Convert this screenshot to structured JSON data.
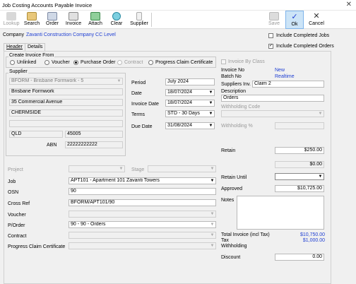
{
  "window": {
    "title": "Job Costing Accounts Payable Invoice",
    "close_symbol": "✕"
  },
  "toolbar": {
    "lookup": "Lookup",
    "search": "Search",
    "order": "Order",
    "invoice": "Invoice",
    "attach": "Attach",
    "clear": "Clear",
    "supplier": "Supplier",
    "save": "Save",
    "ok": "Ok",
    "cancel": "Cancel"
  },
  "company": {
    "label": "Company",
    "value": "Zavanti Construction Company CC Level"
  },
  "options": {
    "include_completed_jobs": "Include Completed Jobs",
    "include_completed_orders": "Include Completed Orders",
    "include_completed_jobs_checked": false,
    "include_completed_orders_checked": true,
    "check_mark": "✓"
  },
  "tabs": {
    "header": "Header",
    "details": "Details"
  },
  "create_from": {
    "label": "Create Invoice From",
    "unlinked": "Unlinked",
    "voucher": "Voucher",
    "purchase_order": "Purchase Order",
    "contract": "Contract",
    "progress_claim": "Progress Claim Certificate",
    "selected": "purchase_order"
  },
  "supplier": {
    "label": "Supplier",
    "code": "BFORM - Brisbane Formwork - 5",
    "name": "Brisbane Formwork",
    "address1": "35 Commercial Avenue",
    "suburb": "CHERMSIDE",
    "state": "QLD",
    "postcode": "45005",
    "abn_label": "ABN",
    "abn": "22222222222"
  },
  "invoice": {
    "period_label": "Period",
    "period": "July 2024",
    "date_label": "Date",
    "date": "18/07/2024",
    "invoice_date_label": "Invoice Date",
    "invoice_date": "18/07/2024",
    "terms_label": "Terms",
    "terms": "STD - 30 Days",
    "due_date_label": "Due Date",
    "due_date": "31/08/2024"
  },
  "right_panel": {
    "invoice_by_class": "Invoice By Class",
    "invoice_no_label": "Invoice No",
    "invoice_no": "New",
    "batch_no_label": "Batch No",
    "batch_no": "Realtime",
    "suppliers_inv_label": "Suppliers Inv.",
    "suppliers_inv": "Claim 2",
    "description_label": "Description",
    "description": "Orders",
    "withholding_code_label": "Withholding Code",
    "withholding_pct_label": "Withholding %",
    "retain_label": "Retain",
    "retain": "$250.00",
    "retain_sub": "$0.00",
    "retain_until_label": "Retain Until",
    "approved_label": "Approved",
    "approved": "$10,725.00",
    "notes_label": "Notes",
    "total_label": "Total Invoice (incl Tax)",
    "total": "$10,750.00",
    "tax_label": "Tax",
    "tax": "$1,000.00",
    "withholding_label": "Withholding",
    "discount_label": "Discount",
    "discount": "0.00"
  },
  "job": {
    "project_label": "Project",
    "stage_label": "Stage",
    "job_label": "Job",
    "job": "APT101 - Apartment 101 Zavanti Towers",
    "osn_label": "OSN",
    "osn": "90",
    "cross_ref_label": "Cross Ref",
    "cross_ref": "BFORM/APT101/90",
    "voucher_label": "Voucher",
    "porder_label": "P/Order",
    "porder": "90 - 90 - Orders",
    "contract_label": "Contract",
    "progress_claim_label": "Progress Claim Certificate"
  },
  "icons": {
    "dropdown": "▼"
  },
  "colors": {
    "accent": "#1f3fd3",
    "disabled": "#9a9a9a"
  }
}
